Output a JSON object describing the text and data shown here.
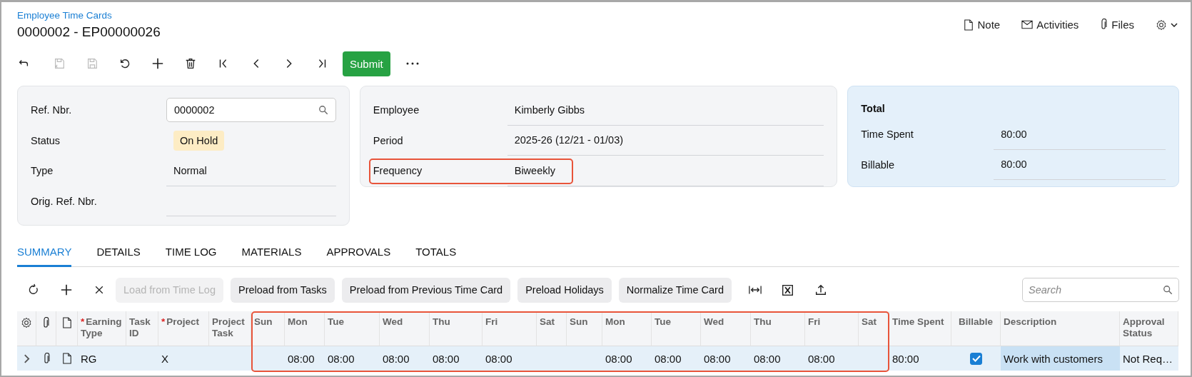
{
  "breadcrumb": "Employee Time Cards",
  "title": "0000002 - EP00000026",
  "header_actions": [
    {
      "kind": "note",
      "label": "Note"
    },
    {
      "kind": "activities",
      "label": "Activities"
    },
    {
      "kind": "files",
      "label": "Files"
    },
    {
      "kind": "settings"
    }
  ],
  "toolbar": [
    {
      "kind": "back",
      "disabled": false
    },
    {
      "kind": "save-close",
      "disabled": true
    },
    {
      "kind": "save",
      "disabled": true
    },
    {
      "kind": "undo",
      "disabled": false
    },
    {
      "kind": "add",
      "disabled": false
    },
    {
      "kind": "delete",
      "disabled": false
    },
    {
      "kind": "first",
      "disabled": false
    },
    {
      "kind": "prev",
      "disabled": false
    },
    {
      "kind": "next",
      "disabled": false
    },
    {
      "kind": "last",
      "disabled": false
    },
    {
      "kind": "submit",
      "label": "Submit",
      "disabled": false
    },
    {
      "kind": "more",
      "disabled": false
    }
  ],
  "cards": [
    {
      "kind": "plain",
      "fields": [
        {
          "label": "Ref. Nbr.",
          "kind": "lookup",
          "value": "0000002",
          "highlighted": false
        },
        {
          "label": "Status",
          "kind": "badge",
          "value": "On Hold",
          "highlighted": false
        },
        {
          "label": "Type",
          "kind": "text",
          "value": "Normal",
          "highlighted": false
        },
        {
          "label": "Orig. Ref. Nbr.",
          "kind": "text",
          "highlighted": false
        }
      ]
    },
    {
      "kind": "plain",
      "fields": [
        {
          "label": "Employee",
          "kind": "text",
          "value": "Kimberly Gibbs",
          "highlighted": false
        },
        {
          "label": "Period",
          "kind": "text",
          "value": "2025-26 (12/21 - 01/03)",
          "highlighted": false
        },
        {
          "label": "Frequency",
          "kind": "text",
          "value": "Biweekly",
          "highlighted": true
        }
      ]
    },
    {
      "kind": "total",
      "heading": "Total",
      "fields": [
        {
          "label": "Time Spent",
          "kind": "text",
          "value": "80:00",
          "highlighted": false
        },
        {
          "label": "Billable",
          "kind": "text",
          "value": "80:00",
          "highlighted": false
        }
      ]
    }
  ],
  "tabs": [
    {
      "label": "SUMMARY",
      "selected": true
    },
    {
      "label": "DETAILS",
      "selected": false
    },
    {
      "label": "TIME LOG",
      "selected": false
    },
    {
      "label": "MATERIALS",
      "selected": false
    },
    {
      "label": "APPROVALS",
      "selected": false
    },
    {
      "label": "TOTALS",
      "selected": false
    }
  ],
  "grid_toolbar": [
    {
      "kind": "refresh",
      "disabled": false
    },
    {
      "kind": "add",
      "disabled": false
    },
    {
      "kind": "remove",
      "disabled": false
    },
    {
      "kind": "button",
      "label": "Load from Time Log",
      "disabled": true
    },
    {
      "kind": "button",
      "label": "Preload from Tasks",
      "disabled": false
    },
    {
      "kind": "button",
      "label": "Preload from Previous Time Card",
      "disabled": false
    },
    {
      "kind": "button",
      "label": "Preload Holidays",
      "disabled": false
    },
    {
      "kind": "button",
      "label": "Normalize Time Card",
      "disabled": false
    },
    {
      "kind": "fit-columns",
      "disabled": false
    },
    {
      "kind": "excel",
      "disabled": false
    },
    {
      "kind": "upload",
      "disabled": false
    }
  ],
  "grid_search": {
    "placeholder": "Search"
  },
  "table": {
    "columns": [
      {
        "kind": "settings",
        "highlighted": false
      },
      {
        "kind": "files",
        "highlighted": false
      },
      {
        "kind": "note",
        "highlighted": false
      },
      {
        "kind": "text",
        "label": "Earning Type",
        "required_mark": "*",
        "highlighted": false
      },
      {
        "kind": "text",
        "label": "Task ID",
        "highlighted": false
      },
      {
        "kind": "text",
        "label": "Project",
        "required_mark": "*",
        "highlighted": false
      },
      {
        "kind": "text",
        "label": "Project Task",
        "highlighted": false
      },
      {
        "kind": "text",
        "label": "Sun",
        "highlighted": true
      },
      {
        "kind": "text",
        "label": "Mon",
        "highlighted": true
      },
      {
        "kind": "text",
        "label": "Tue",
        "highlighted": true
      },
      {
        "kind": "text",
        "label": "Wed",
        "highlighted": true
      },
      {
        "kind": "text",
        "label": "Thu",
        "highlighted": true
      },
      {
        "kind": "text",
        "label": "Fri",
        "highlighted": true
      },
      {
        "kind": "text",
        "label": "Sat",
        "highlighted": true
      },
      {
        "kind": "text",
        "label": "Sun",
        "highlighted": true
      },
      {
        "kind": "text",
        "label": "Mon",
        "highlighted": true
      },
      {
        "kind": "text",
        "label": "Tue",
        "highlighted": true
      },
      {
        "kind": "text",
        "label": "Wed",
        "highlighted": true
      },
      {
        "kind": "text",
        "label": "Thu",
        "highlighted": true
      },
      {
        "kind": "text",
        "label": "Fri",
        "highlighted": true
      },
      {
        "kind": "text",
        "label": "Sat",
        "highlighted": true
      },
      {
        "kind": "text",
        "label": "Time Spent",
        "highlighted": false
      },
      {
        "kind": "checkbox",
        "label": "Billable",
        "highlighted": false
      },
      {
        "kind": "text",
        "label": "Description",
        "highlighted": false
      },
      {
        "kind": "text",
        "label": "Approval Status",
        "highlighted": false
      }
    ],
    "rows": [
      {
        "cells": [
          {
            "kind": "expand",
            "expanded": false,
            "selected": false
          },
          {
            "kind": "files",
            "selected": false
          },
          {
            "kind": "note",
            "selected": false
          },
          {
            "kind": "text",
            "text": "RG",
            "selected": false
          },
          {
            "kind": "text",
            "selected": false
          },
          {
            "kind": "text",
            "text": "X",
            "selected": false
          },
          {
            "kind": "text",
            "selected": false
          },
          {
            "kind": "text",
            "selected": false
          },
          {
            "kind": "text",
            "text": "08:00",
            "selected": false
          },
          {
            "kind": "text",
            "text": "08:00",
            "selected": false
          },
          {
            "kind": "text",
            "text": "08:00",
            "selected": false
          },
          {
            "kind": "text",
            "text": "08:00",
            "selected": false
          },
          {
            "kind": "text",
            "text": "08:00",
            "selected": false
          },
          {
            "kind": "text",
            "selected": false
          },
          {
            "kind": "text",
            "selected": false
          },
          {
            "kind": "text",
            "text": "08:00",
            "selected": false
          },
          {
            "kind": "text",
            "text": "08:00",
            "selected": false
          },
          {
            "kind": "text",
            "text": "08:00",
            "selected": false
          },
          {
            "kind": "text",
            "text": "08:00",
            "selected": false
          },
          {
            "kind": "text",
            "text": "08:00",
            "selected": false
          },
          {
            "kind": "text",
            "selected": false
          },
          {
            "kind": "text",
            "text": "80:00",
            "selected": false
          },
          {
            "kind": "checkbox",
            "checked": true,
            "selected": false
          },
          {
            "kind": "text",
            "text": "Work with customers",
            "selected": true
          },
          {
            "kind": "text",
            "text": "Not Req…",
            "selected": false
          }
        ]
      }
    ]
  }
}
